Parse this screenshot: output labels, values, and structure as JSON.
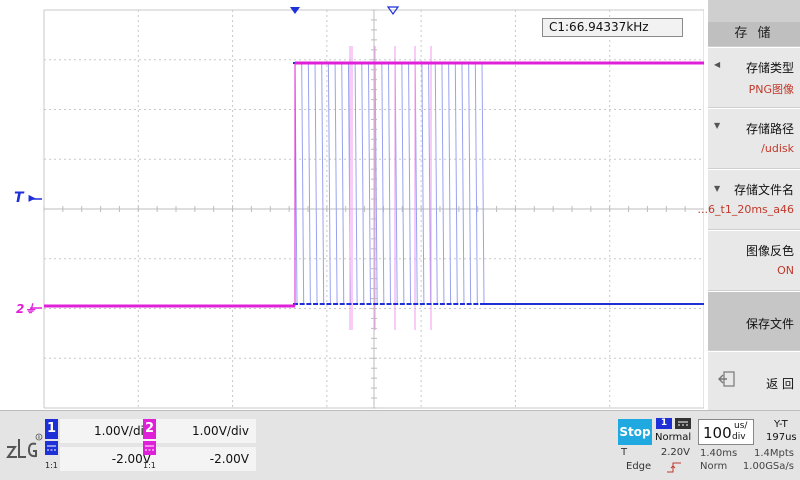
{
  "measurement": {
    "text": "C1:66.94337kHz"
  },
  "trigger_marker": {
    "label": "T"
  },
  "ch2_marker": {
    "label": "2"
  },
  "menu": {
    "title": "存 储",
    "items": [
      {
        "label": "存储类型",
        "value": "PNG图像"
      },
      {
        "label": "存储路径",
        "value": "/udisk"
      },
      {
        "label": "存储文件名",
        "value": "...6_t1_20ms_a46"
      },
      {
        "label": "图像反色",
        "value": "ON"
      },
      {
        "label": "保存文件"
      },
      {
        "label": "返 回"
      }
    ]
  },
  "channels": [
    {
      "number": "1",
      "scale": "1.00V/div",
      "offset": "-2.00V",
      "ratio": "1:1",
      "color": "#1e2fd8"
    },
    {
      "number": "2",
      "scale": "1.00V/div",
      "offset": "-2.00V",
      "ratio": "1:1",
      "color": "#e020d8"
    }
  ],
  "acquisition": {
    "status": "Stop",
    "trigger_channel": "1",
    "trigger_mode": "Normal",
    "trigger_type": "T",
    "trigger_level": "2.20V",
    "trigger_edge": "Edge",
    "timebase_value": "100",
    "timebase_unit_top": "us/",
    "timebase_unit_bottom": "div",
    "display_mode": "Y-T",
    "horizontal_position": "197us",
    "record_length_time": "1.40ms",
    "memory_depth": "1.4Mpts",
    "acq_mode": "Norm",
    "sample_rate": "1.00GSa/s"
  },
  "colors": {
    "ch1": "#1e2fd8",
    "ch2": "#e020d8",
    "ch1_faint": "#9aa2ee",
    "ch2_faint": "#f09aec",
    "grid": "#c8c8c8",
    "status_blue": "#1fa9e0",
    "menu_value": "#c0392b"
  },
  "icons": {
    "logo": "zlg-logo",
    "trigger_pointer": "triangle-down-icon",
    "back": "return-icon",
    "coupling": "dc-coupling-icon",
    "edge": "rising-edge-icon"
  }
}
